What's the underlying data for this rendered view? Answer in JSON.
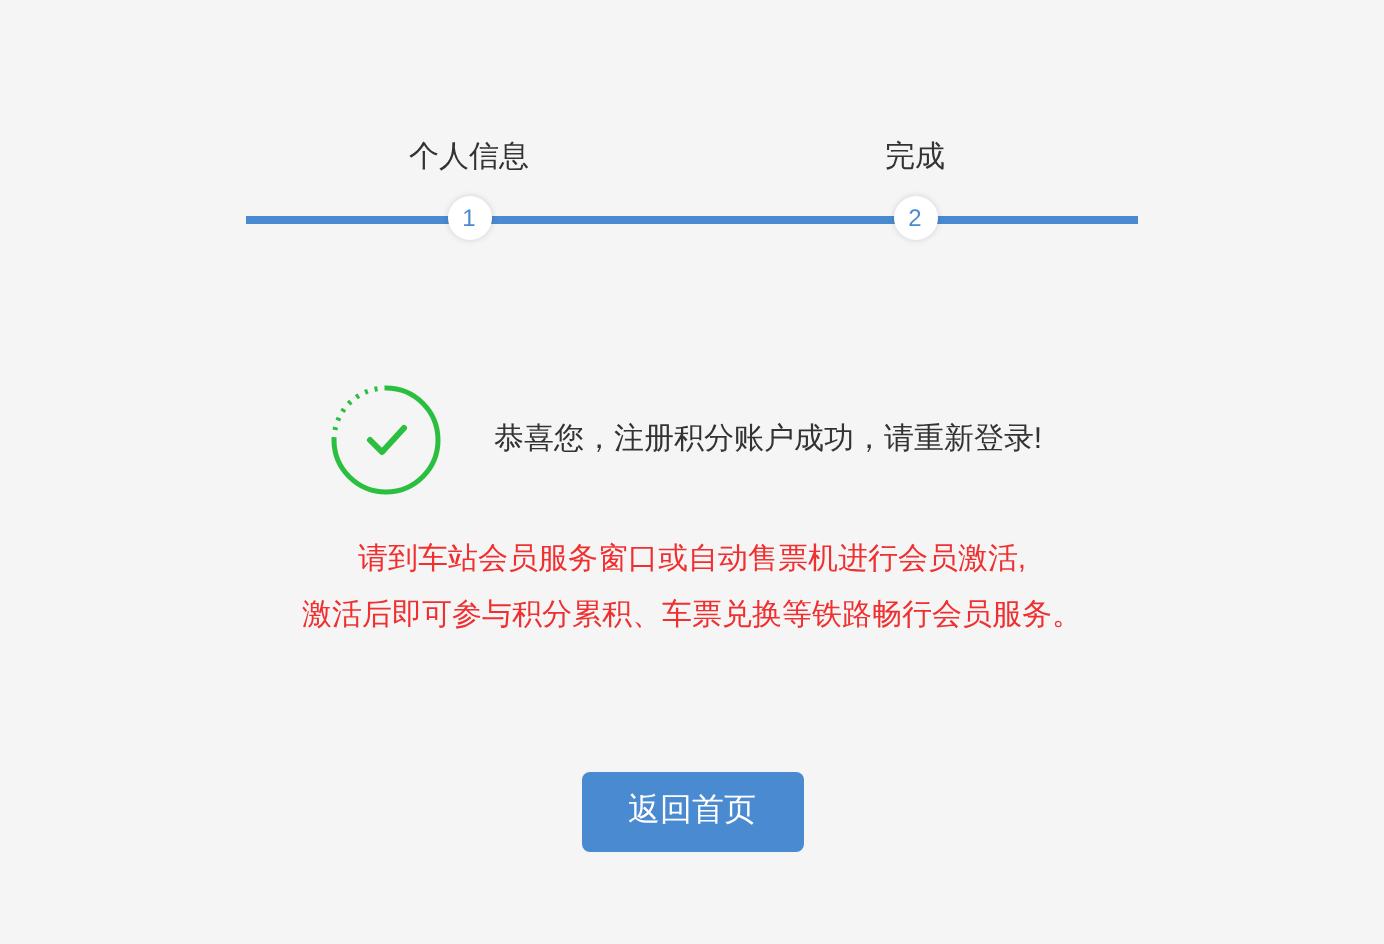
{
  "steps": [
    {
      "label": "个人信息",
      "number": "1"
    },
    {
      "label": "完成",
      "number": "2"
    }
  ],
  "message": "恭喜您，注册积分账户成功，请重新登录!",
  "notice": [
    "请到车站会员服务窗口或自动售票机进行会员激活,",
    "激活后即可参与积分累积、车票兑换等铁路畅行会员服务。"
  ],
  "button": "返回首页"
}
